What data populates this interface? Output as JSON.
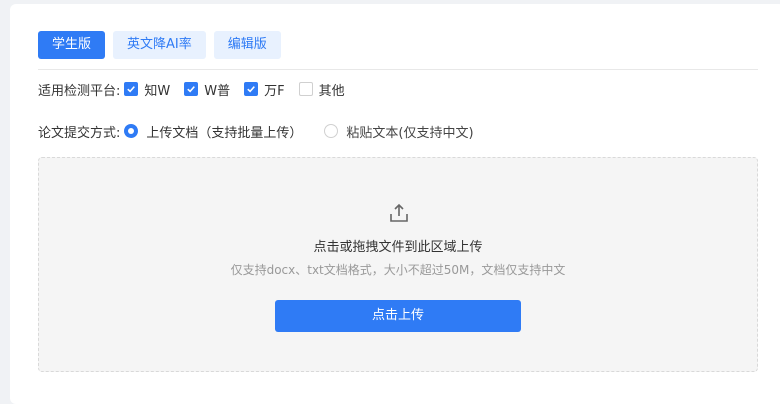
{
  "tabs": [
    {
      "label": "学生版"
    },
    {
      "label": "英文降AI率"
    },
    {
      "label": "编辑版"
    }
  ],
  "platforms": {
    "label": "适用检测平台:",
    "options": [
      {
        "label": "知W"
      },
      {
        "label": "W普"
      },
      {
        "label": "万F"
      },
      {
        "label": "其他"
      }
    ]
  },
  "submit_method": {
    "label": "论文提交方式:",
    "options": [
      {
        "label": "上传文档（支持批量上传）"
      },
      {
        "label": "粘贴文本(仅支持中文)"
      }
    ]
  },
  "dropzone": {
    "title": "点击或拖拽文件到此区域上传",
    "hint": "仅支持docx、txt文档格式，大小不超过50M，文档仅支持中文",
    "button_label": "点击上传",
    "icon": "upload-icon"
  },
  "colors": {
    "primary": "#2f7bf5",
    "tab_inactive_bg": "#e8f1fe",
    "dropzone_bg": "#f5f5f5"
  }
}
